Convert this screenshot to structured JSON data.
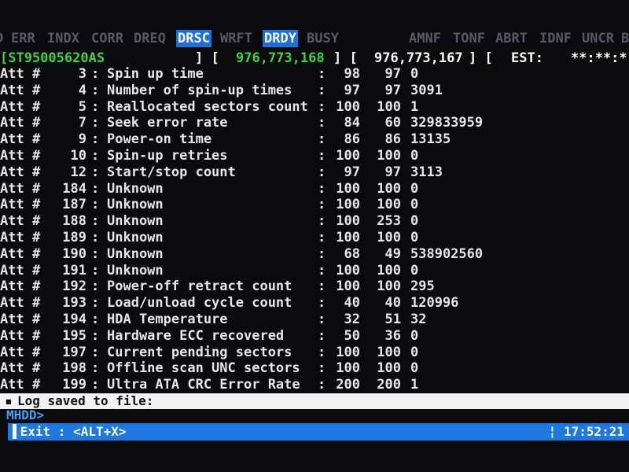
{
  "flags": [
    {
      "label": "D",
      "active": false
    },
    {
      "label": "ERR",
      "active": false
    },
    {
      "label": "INDX",
      "active": false
    },
    {
      "label": "CORR",
      "active": false
    },
    {
      "label": "DREQ",
      "active": false
    },
    {
      "label": "DRSC",
      "active": true
    },
    {
      "label": "WRFT",
      "active": false
    },
    {
      "label": "DRDY",
      "active": true
    },
    {
      "label": "BUSY",
      "active": false
    },
    {
      "label": "AMNF",
      "active": false
    },
    {
      "label": "TONF",
      "active": false
    },
    {
      "label": "ABRT",
      "active": false
    },
    {
      "label": "IDNF",
      "active": false
    },
    {
      "label": "UNCR",
      "active": false
    },
    {
      "label": "B",
      "active": false
    }
  ],
  "drive": {
    "model": "[ST95005620AS",
    "bracket1": "] [",
    "lba_total": "976,773,168",
    "bracket2": "] [",
    "lba_max": "976,773,167",
    "bracket3": "] [",
    "est_label": "EST:",
    "est_value": "**:**:*"
  },
  "smart_rows": [
    {
      "att": "Att #",
      "id": "3",
      "name": "Spin up time",
      "v1": "98",
      "v2": "97",
      "raw": "0"
    },
    {
      "att": "Att #",
      "id": "4",
      "name": "Number of spin-up times",
      "v1": "97",
      "v2": "97",
      "raw": "3091"
    },
    {
      "att": "Att #",
      "id": "5",
      "name": "Reallocated sectors count",
      "v1": "100",
      "v2": "100",
      "raw": "1"
    },
    {
      "att": "Att #",
      "id": "7",
      "name": "Seek error rate",
      "v1": "84",
      "v2": "60",
      "raw": "329833959"
    },
    {
      "att": "Att #",
      "id": "9",
      "name": "Power-on time",
      "v1": "86",
      "v2": "86",
      "raw": "13135"
    },
    {
      "att": "Att #",
      "id": "10",
      "name": "Spin-up retries",
      "v1": "100",
      "v2": "100",
      "raw": "0"
    },
    {
      "att": "Att #",
      "id": "12",
      "name": "Start/stop count",
      "v1": "97",
      "v2": "97",
      "raw": "3113"
    },
    {
      "att": "Att #",
      "id": "184",
      "name": "Unknown",
      "v1": "100",
      "v2": "100",
      "raw": "0"
    },
    {
      "att": "Att #",
      "id": "187",
      "name": "Unknown",
      "v1": "100",
      "v2": "100",
      "raw": "0"
    },
    {
      "att": "Att #",
      "id": "188",
      "name": "Unknown",
      "v1": "100",
      "v2": "253",
      "raw": "0"
    },
    {
      "att": "Att #",
      "id": "189",
      "name": "Unknown",
      "v1": "100",
      "v2": "100",
      "raw": "0"
    },
    {
      "att": "Att #",
      "id": "190",
      "name": "Unknown",
      "v1": "68",
      "v2": "49",
      "raw": "538902560"
    },
    {
      "att": "Att #",
      "id": "191",
      "name": "Unknown",
      "v1": "100",
      "v2": "100",
      "raw": "0"
    },
    {
      "att": "Att #",
      "id": "192",
      "name": "Power-off retract count",
      "v1": "100",
      "v2": "100",
      "raw": "295"
    },
    {
      "att": "Att #",
      "id": "193",
      "name": "Load/unload cycle count",
      "v1": "40",
      "v2": "40",
      "raw": "120996"
    },
    {
      "att": "Att #",
      "id": "194",
      "name": "HDA Temperature",
      "v1": "32",
      "v2": "51",
      "raw": "32"
    },
    {
      "att": "Att #",
      "id": "195",
      "name": "Hardware ECC recovered",
      "v1": "50",
      "v2": "36",
      "raw": "0"
    },
    {
      "att": "Att #",
      "id": "197",
      "name": "Current pending sectors",
      "v1": "100",
      "v2": "100",
      "raw": "0"
    },
    {
      "att": "Att #",
      "id": "198",
      "name": "Offline scan UNC sectors",
      "v1": "100",
      "v2": "100",
      "raw": "0"
    },
    {
      "att": "Att #",
      "id": "199",
      "name": "Ultra ATA CRC Error Rate",
      "v1": "200",
      "v2": "200",
      "raw": "1"
    }
  ],
  "log": {
    "bullet": "▪",
    "text": "Log saved to file:"
  },
  "prompt": "MHDD>",
  "statusbar": {
    "exit": "▌Exit : <ALT+X>",
    "clock": "¦ 17:52:21"
  },
  "colors": {
    "background": "#0b0b0e",
    "accent_blue": "#1f78e0",
    "model_green": "#3ed23e",
    "inactive_flag": "#55596a"
  }
}
